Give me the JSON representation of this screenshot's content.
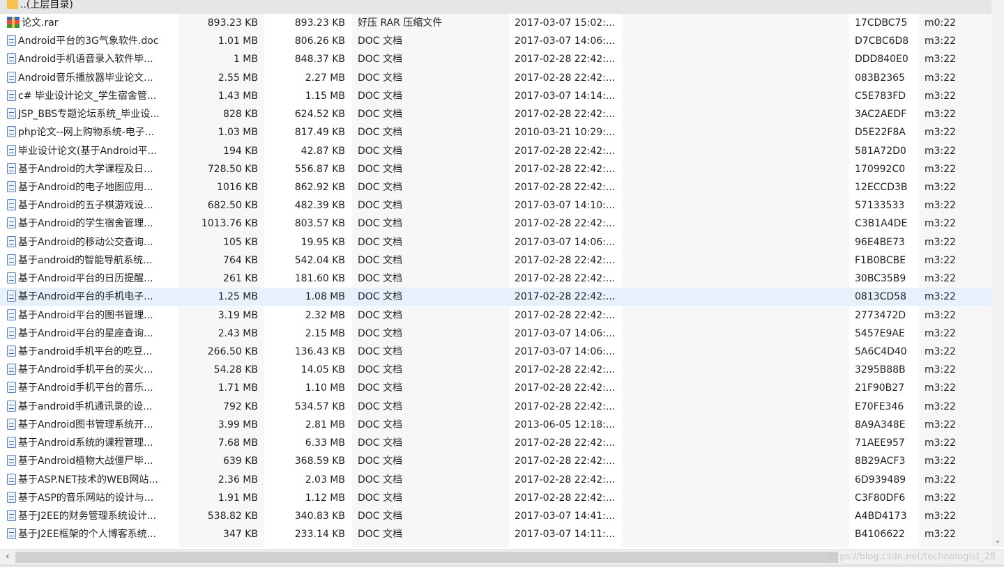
{
  "parent_row": {
    "label": "..(上层目录)"
  },
  "rows": [
    {
      "name": "论文.rar",
      "size": "893.23 KB",
      "packed": "893.23 KB",
      "type": "好压 RAR 压缩文件",
      "modified": "2017-03-07 15:02:...",
      "crc": "17CDBC75",
      "version": "m0:22",
      "icon": "rar-archive-icon"
    },
    {
      "name": "Android平台的3G气象软件.doc",
      "size": "1.01 MB",
      "packed": "806.26 KB",
      "type": "DOC 文档",
      "modified": "2017-03-07 14:06:...",
      "crc": "D7CBC6D8",
      "version": "m3:22",
      "icon": "doc-file-icon"
    },
    {
      "name": "Android手机语音录入软件毕...",
      "size": "1 MB",
      "packed": "848.37 KB",
      "type": "DOC 文档",
      "modified": "2017-02-28 22:42:...",
      "crc": "DDD840E0",
      "version": "m3:22",
      "icon": "doc-file-icon"
    },
    {
      "name": "Android音乐播放器毕业论文...",
      "size": "2.55 MB",
      "packed": "2.27 MB",
      "type": "DOC 文档",
      "modified": "2017-02-28 22:42:...",
      "crc": "083B2365",
      "version": "m3:22",
      "icon": "doc-file-icon"
    },
    {
      "name": "c# 毕业设计论文_学生宿舍管...",
      "size": "1.43 MB",
      "packed": "1.15 MB",
      "type": "DOC 文档",
      "modified": "2017-03-07 14:14:...",
      "crc": "C5E783FD",
      "version": "m3:22",
      "icon": "doc-file-icon"
    },
    {
      "name": "JSP_BBS专题论坛系统_毕业设...",
      "size": "828 KB",
      "packed": "624.52 KB",
      "type": "DOC 文档",
      "modified": "2017-02-28 22:42:...",
      "crc": "3AC2AEDF",
      "version": "m3:22",
      "icon": "doc-file-icon"
    },
    {
      "name": "php论文--网上购物系统-电子...",
      "size": "1.03 MB",
      "packed": "817.49 KB",
      "type": "DOC 文档",
      "modified": "2010-03-21 10:29:...",
      "crc": "D5E22F8A",
      "version": "m3:22",
      "icon": "doc-file-icon"
    },
    {
      "name": "毕业设计论文(基于Android平...",
      "size": "194 KB",
      "packed": "42.87 KB",
      "type": "DOC 文档",
      "modified": "2017-02-28 22:42:...",
      "crc": "581A72D0",
      "version": "m3:22",
      "icon": "doc-file-icon"
    },
    {
      "name": "基于Android的大学课程及日...",
      "size": "728.50 KB",
      "packed": "556.87 KB",
      "type": "DOC 文档",
      "modified": "2017-02-28 22:42:...",
      "crc": "170992C0",
      "version": "m3:22",
      "icon": "doc-file-icon"
    },
    {
      "name": "基于Android的电子地图应用...",
      "size": "1016 KB",
      "packed": "862.92 KB",
      "type": "DOC 文档",
      "modified": "2017-02-28 22:42:...",
      "crc": "12ECCD3B",
      "version": "m3:22",
      "icon": "doc-file-icon"
    },
    {
      "name": "基于Android的五子棋游戏设...",
      "size": "682.50 KB",
      "packed": "482.39 KB",
      "type": "DOC 文档",
      "modified": "2017-03-07 14:10:...",
      "crc": "57133533",
      "version": "m3:22",
      "icon": "doc-file-icon"
    },
    {
      "name": "基于Android的学生宿舍管理...",
      "size": "1013.76 KB",
      "packed": "803.57 KB",
      "type": "DOC 文档",
      "modified": "2017-02-28 22:42:...",
      "crc": "C3B1A4DE",
      "version": "m3:22",
      "icon": "doc-file-icon"
    },
    {
      "name": "基于Android的移动公交查询...",
      "size": "105 KB",
      "packed": "19.95 KB",
      "type": "DOC 文档",
      "modified": "2017-03-07 14:06:...",
      "crc": "96E4BE73",
      "version": "m3:22",
      "icon": "doc-file-icon"
    },
    {
      "name": "基于android的智能导航系统...",
      "size": "764 KB",
      "packed": "542.04 KB",
      "type": "DOC 文档",
      "modified": "2017-02-28 22:42:...",
      "crc": "F1B0BCBE",
      "version": "m3:22",
      "icon": "doc-file-icon"
    },
    {
      "name": "基于Android平台的日历提醒...",
      "size": "261 KB",
      "packed": "181.60 KB",
      "type": "DOC 文档",
      "modified": "2017-02-28 22:42:...",
      "crc": "30BC35B9",
      "version": "m3:22",
      "icon": "doc-file-icon"
    },
    {
      "name": "基于Android平台的手机电子...",
      "size": "1.25 MB",
      "packed": "1.08 MB",
      "type": "DOC 文档",
      "modified": "2017-02-28 22:42:...",
      "crc": "0813CD58",
      "version": "m3:22",
      "icon": "doc-file-icon",
      "selected": true
    },
    {
      "name": "基于Android平台的图书管理...",
      "size": "3.19 MB",
      "packed": "2.32 MB",
      "type": "DOC 文档",
      "modified": "2017-02-28 22:42:...",
      "crc": "2773472D",
      "version": "m3:22",
      "icon": "doc-file-icon"
    },
    {
      "name": "基于Android平台的星座查询...",
      "size": "2.43 MB",
      "packed": "2.15 MB",
      "type": "DOC 文档",
      "modified": "2017-03-07 14:06:...",
      "crc": "5457E9AE",
      "version": "m3:22",
      "icon": "doc-file-icon"
    },
    {
      "name": "基于android手机平台的吃豆...",
      "size": "266.50 KB",
      "packed": "136.43 KB",
      "type": "DOC 文档",
      "modified": "2017-03-07 14:06:...",
      "crc": "5A6C4D40",
      "version": "m3:22",
      "icon": "doc-file-icon"
    },
    {
      "name": "基于Android手机平台的买火...",
      "size": "54.28 KB",
      "packed": "14.05 KB",
      "type": "DOC 文档",
      "modified": "2017-02-28 22:42:...",
      "crc": "3295B88B",
      "version": "m3:22",
      "icon": "doc-file-icon"
    },
    {
      "name": "基于Android手机平台的音乐...",
      "size": "1.71 MB",
      "packed": "1.10 MB",
      "type": "DOC 文档",
      "modified": "2017-02-28 22:42:...",
      "crc": "21F90B27",
      "version": "m3:22",
      "icon": "doc-file-icon"
    },
    {
      "name": "基于android手机通讯录的设...",
      "size": "792 KB",
      "packed": "534.57 KB",
      "type": "DOC 文档",
      "modified": "2017-02-28 22:42:...",
      "crc": "E70FE346",
      "version": "m3:22",
      "icon": "doc-file-icon"
    },
    {
      "name": "基于Android图书管理系统开...",
      "size": "3.99 MB",
      "packed": "2.81 MB",
      "type": "DOC 文档",
      "modified": "2013-06-05 12:18:...",
      "crc": "8A9A348E",
      "version": "m3:22",
      "icon": "doc-file-icon"
    },
    {
      "name": "基于Android系统的课程管理...",
      "size": "7.68 MB",
      "packed": "6.33 MB",
      "type": "DOC 文档",
      "modified": "2017-02-28 22:42:...",
      "crc": "71AEE957",
      "version": "m3:22",
      "icon": "doc-file-icon"
    },
    {
      "name": "基于Android植物大战僵尸毕...",
      "size": "639 KB",
      "packed": "368.59 KB",
      "type": "DOC 文档",
      "modified": "2017-02-28 22:42:...",
      "crc": "8B29ACF3",
      "version": "m3:22",
      "icon": "doc-file-icon"
    },
    {
      "name": "基于ASP.NET技术的WEB网站...",
      "size": "2.36 MB",
      "packed": "2.03 MB",
      "type": "DOC 文档",
      "modified": "2017-02-28 22:42:...",
      "crc": "6D939489",
      "version": "m3:22",
      "icon": "doc-file-icon"
    },
    {
      "name": "基于ASP的音乐网站的设计与...",
      "size": "1.91 MB",
      "packed": "1.12 MB",
      "type": "DOC 文档",
      "modified": "2017-02-28 22:42:...",
      "crc": "C3F80DF6",
      "version": "m3:22",
      "icon": "doc-file-icon"
    },
    {
      "name": "基于J2EE的财务管理系统设计...",
      "size": "538.82 KB",
      "packed": "340.83 KB",
      "type": "DOC 文档",
      "modified": "2017-03-07 14:41:...",
      "crc": "A4BD4173",
      "version": "m3:22",
      "icon": "doc-file-icon"
    },
    {
      "name": "基于J2EE框架的个人博客系统...",
      "size": "347 KB",
      "packed": "233.14 KB",
      "type": "DOC 文档",
      "modified": "2017-03-07 14:11:...",
      "crc": "B4106622",
      "version": "m3:22",
      "icon": "doc-file-icon"
    }
  ],
  "scrollbars": {
    "vertical_down_arrow": "⌄",
    "horizontal_left_arrow": "‹"
  },
  "watermark": "https://blog.csdn.net/technologist_28",
  "colors": {
    "selected_row": "#e6f1fb",
    "alt_column": "#f7f7f7",
    "text": "#1f1f1f"
  }
}
